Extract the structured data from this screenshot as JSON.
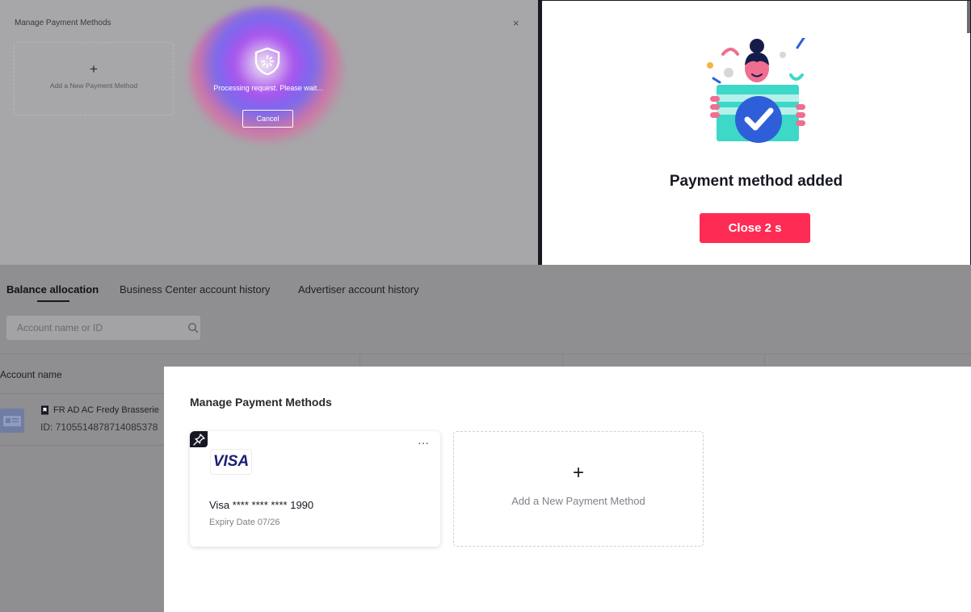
{
  "processing_panel": {
    "title": "Manage Payment Methods",
    "close_symbol": "×",
    "add_plus": "+",
    "add_label": "Add a New Payment Method",
    "status_text": "Processing request. Please wait...",
    "cancel_label": "Cancel",
    "shield_icon": "shield-loading-icon"
  },
  "success_panel": {
    "message": "Payment method added",
    "close_button_label": "Close 2 s",
    "accent_color": "#fe2c55",
    "illustration": "person-holding-card-checkmark-illustration"
  },
  "background_page": {
    "tabs": [
      {
        "label": "Balance allocation",
        "active": true
      },
      {
        "label": "Business Center account history",
        "active": false
      },
      {
        "label": "Advertiser account history",
        "active": false
      }
    ],
    "search": {
      "placeholder": "Account name or ID",
      "icon": "search-icon"
    },
    "table": {
      "columns": [
        "Account name"
      ],
      "rows": [
        {
          "name": "FR AD AC Fredy Brasserie",
          "id": "ID: 7105514878714085378"
        }
      ]
    }
  },
  "payment_modal": {
    "title": "Manage Payment Methods",
    "cards": [
      {
        "brand": "VISA",
        "number": "Visa **** **** **** 1990",
        "expiry": "Expiry Date 07/26",
        "menu": "···"
      }
    ],
    "add_plus": "+",
    "add_label": "Add a New Payment Method"
  }
}
